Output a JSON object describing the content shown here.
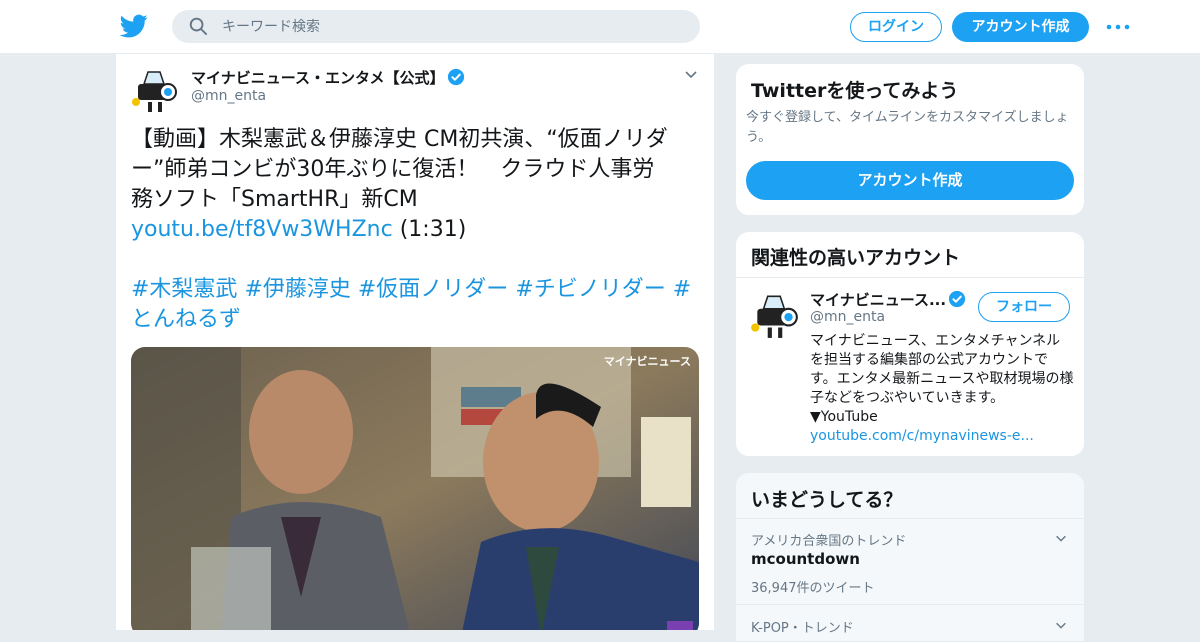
{
  "header": {
    "search_placeholder": "キーワード検索",
    "login_label": "ログイン",
    "signup_label": "アカウント作成"
  },
  "tweet": {
    "author_name": "マイナビニュース・エンタメ【公式】",
    "author_handle": "@mn_enta",
    "text_line1": "【動画】木梨憲武＆伊藤淳史 CM初共演、“仮面ノリダ",
    "text_line2": "ー”師弟コンビが30年ぶりに復活！　クラウド人事労",
    "text_line3": "務ソフト「SmartHR」新CM",
    "link": "youtu.be/tf8Vw3WHZnc",
    "duration": "(1:31)",
    "hashtags": [
      "#木梨憲武",
      "#伊藤淳史",
      "#仮面ノリダー",
      "#チビノリダー",
      "#とんねるず"
    ],
    "hashtag_line2": "とんねるず",
    "media_watermark": "マイナビニュース"
  },
  "signup_card": {
    "title": "Twitterを使ってみよう",
    "description": "今すぐ登録して、タイムラインをカスタマイズしましょう。",
    "button_label": "アカウント作成"
  },
  "related_card": {
    "title": "関連性の高いアカウント",
    "name": "マイナビニュース...",
    "handle": "@mn_enta",
    "follow_label": "フォロー",
    "bio": "マイナビニュース、エンタメチャンネルを担当する編集部の公式アカウントです。エンタメ最新ニュースや取材現場の様子などをつぶやいていきます。 ▼YouTube",
    "bio_link": "youtube.com/c/mynavinews-e..."
  },
  "trends_card": {
    "title": "いまどうしてる？",
    "trends": [
      {
        "context": "アメリカ合衆国のトレンド",
        "name": "mcountdown",
        "count": "36,947件のツイート"
      },
      {
        "context": "K-POP・トレンド",
        "name": "",
        "count": ""
      }
    ]
  },
  "colors": {
    "accent": "#1da1f2",
    "link": "#1b95e0",
    "verified": "#1da1f2"
  }
}
